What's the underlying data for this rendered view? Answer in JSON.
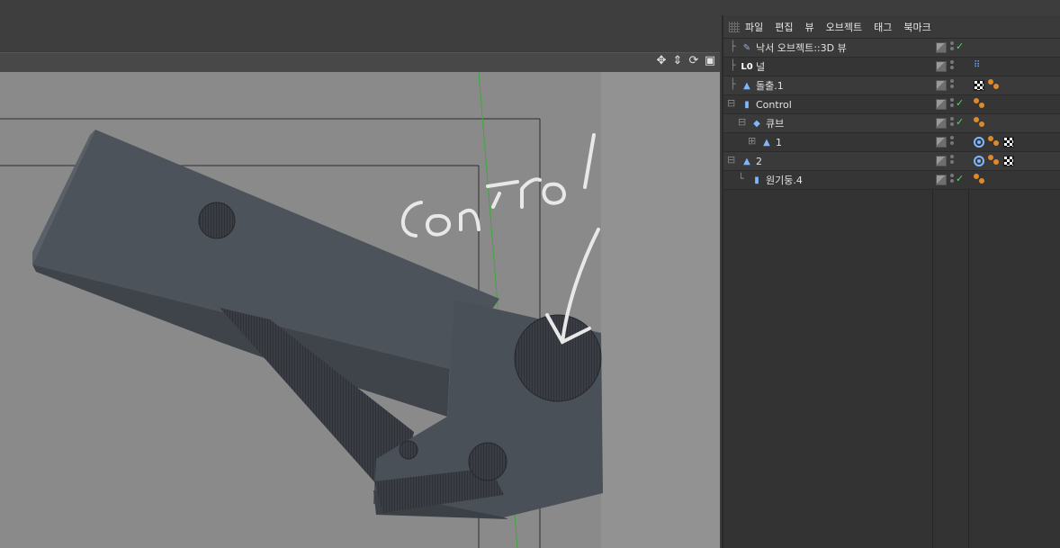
{
  "object_manager": {
    "menu": [
      "파일",
      "편집",
      "뷰",
      "오브젝트",
      "태그",
      "북마크"
    ],
    "rows": [
      {
        "label": "낙서 오브젝트::3D 뷰",
        "indent": 0,
        "icon": "doodle-icon",
        "checked": true,
        "tags": []
      },
      {
        "label": "널",
        "indent": 0,
        "icon": "null-icon",
        "checked": false,
        "tags": [
          "null-dots"
        ]
      },
      {
        "label": "돌출.1",
        "indent": 0,
        "icon": "extrude-icon",
        "checked": false,
        "tags": [
          "checker",
          "phong"
        ]
      },
      {
        "label": "Control",
        "indent": 0,
        "icon": "cylinder-icon",
        "checked": true,
        "tags": [
          "phong"
        ],
        "expand": true
      },
      {
        "label": "큐브",
        "indent": 1,
        "icon": "cube-icon",
        "checked": true,
        "tags": [
          "phong"
        ],
        "expand": true
      },
      {
        "label": "1",
        "indent": 2,
        "icon": "extrude-icon",
        "checked": false,
        "tags": [
          "target",
          "phong",
          "checker"
        ],
        "expand": true
      },
      {
        "label": "2",
        "indent": 0,
        "icon": "extrude-icon",
        "checked": false,
        "tags": [
          "target",
          "phong",
          "checker"
        ],
        "expand": true
      },
      {
        "label": "원기둥.4",
        "indent": 1,
        "icon": "cylinder-icon",
        "checked": true,
        "tags": [
          "phong"
        ]
      }
    ]
  },
  "viewport": {
    "nav_icons": [
      "move-view-icon",
      "zoom-view-icon",
      "rotate-view-icon",
      "maximize-view-icon"
    ],
    "doodle_text": "control",
    "colors": {
      "canvas_bg": "#8a8a8a",
      "model": "#4f555c",
      "axis": "#3fa83f"
    }
  }
}
